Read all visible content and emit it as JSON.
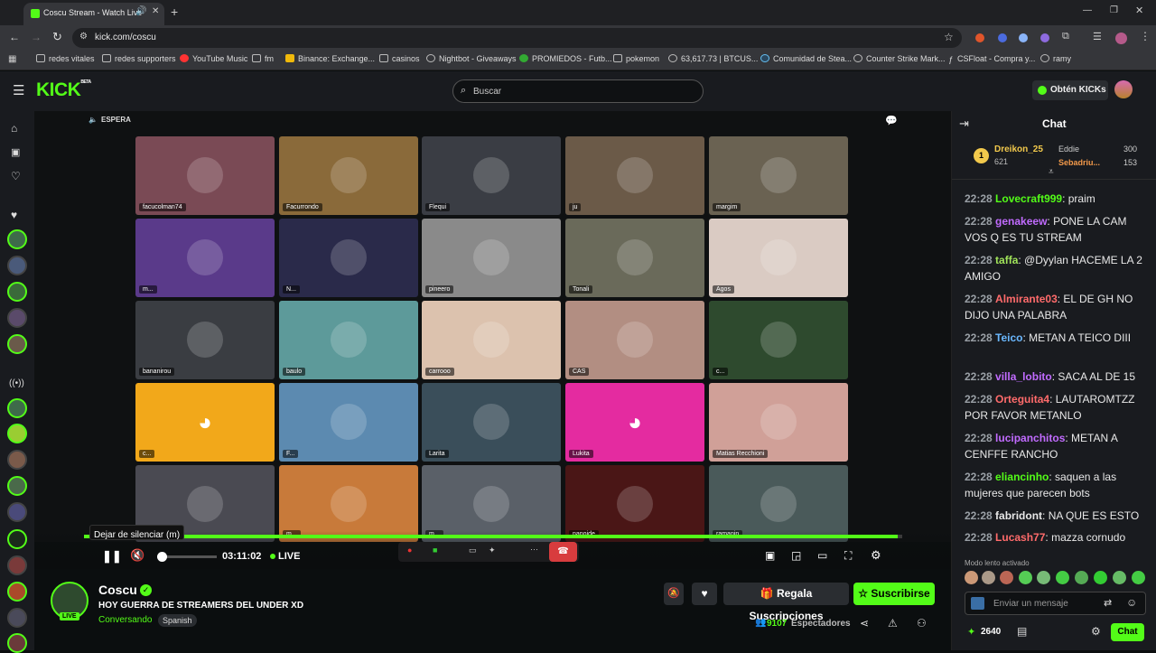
{
  "browser": {
    "tab_title": "Coscu Stream - Watch Live",
    "url": "kick.com/coscu",
    "bookmarks": [
      "redes vitales",
      "redes supporters",
      "YouTube Music",
      "fm",
      "Binance: Exchange...",
      "casinos",
      "Nightbot - Giveaways",
      "PROMIEDOS - Futb...",
      "pokemon",
      "63,617.73 | BTCUS...",
      "Comunidad de Stea...",
      "Counter Strike Mark...",
      "CSFloat - Compra y...",
      "ramy"
    ]
  },
  "header": {
    "logo": "KICK",
    "logo_badge": "BETA",
    "search_placeholder": "Buscar",
    "get_kicks": "Obtén KICKs"
  },
  "video": {
    "status": "ESPERA",
    "tiles": [
      {
        "name": "facucolman74",
        "color": "#7a4a55"
      },
      {
        "name": "Facurrondo",
        "color": "#8a6a3a"
      },
      {
        "name": "Flequi",
        "color": "#3a3d44"
      },
      {
        "name": "ju",
        "color": "#6b5a48"
      },
      {
        "name": "margim",
        "color": "#6a6252"
      },
      {
        "name": "m...",
        "color": "#5a3a8a"
      },
      {
        "name": "N...",
        "color": "#2a2a4a"
      },
      {
        "name": "pineero",
        "color": "#8a8a8a"
      },
      {
        "name": "Tonali",
        "color": "#6a6a5a"
      },
      {
        "name": "Agos",
        "color": "#dacbc3"
      },
      {
        "name": "bananirou",
        "color": "#3a3d42"
      },
      {
        "name": "baulo",
        "color": "#5d9a9a"
      },
      {
        "name": "carrooo",
        "color": "#dcc2ae"
      },
      {
        "name": "CAS",
        "color": "#b28e82"
      },
      {
        "name": "c...",
        "color": "#2e4a2e"
      },
      {
        "name": "c...",
        "color": "#f2a81a"
      },
      {
        "name": "F...",
        "color": "#5c8ab0"
      },
      {
        "name": "Larita",
        "color": "#3a4e5a"
      },
      {
        "name": "Lukita",
        "color": "#e42ba0"
      },
      {
        "name": "Matias Recchioni",
        "color": "#d0a098"
      },
      {
        "name": "",
        "color": "#4a4a52"
      },
      {
        "name": "m...",
        "color": "#c87a3a"
      },
      {
        "name": "m...",
        "color": "#5a6068"
      },
      {
        "name": "nanoide",
        "color": "#4a1616"
      },
      {
        "name": "ramanin",
        "color": "#4a5a5a"
      }
    ],
    "tooltip": "Dejar de silenciar (m)",
    "time": "03:11:02",
    "live": "LIVE",
    "progress": 0.995
  },
  "stream": {
    "channel": "Coscu",
    "title": "HOY GUERRA DE STREAMERS DEL UNDER XD",
    "category": "Conversando",
    "language": "Spanish",
    "live_badge": "LIVE",
    "gift_subs": "Regala Suscripciones",
    "subscribe": "Suscribirse",
    "viewers": "9107",
    "viewers_label": "Espectadores"
  },
  "chat": {
    "title": "Chat",
    "leaderboard": [
      {
        "name": "Dreikon_25",
        "value": "621"
      },
      {
        "name": "Eddie",
        "value": "300"
      },
      {
        "name": "Sebadriu...",
        "value": "153"
      }
    ],
    "messages": [
      {
        "time": "22:28",
        "user": "Lovecraft999",
        "color": "#53fc18",
        "text": ": praim"
      },
      {
        "time": "22:28",
        "user": "genakeew",
        "color": "#c16bff",
        "text": ": PONE LA CAM VOS Q ES TU STREAM"
      },
      {
        "time": "22:28",
        "user": "taffa",
        "color": "#a0e35a",
        "text": ": @Dyylan HACEME LA 2 AMIGO"
      },
      {
        "time": "22:28",
        "user": "Almirante03",
        "color": "#ff6b6b",
        "text": ": EL DE GH NO DIJO UNA PALABRA"
      },
      {
        "time": "22:28",
        "user": "Teico",
        "color": "#6ab8ff",
        "text": ": METAN A TEICO DIII"
      },
      {
        "time": "22:28",
        "user": "villa_lobito",
        "color": "#c16bff",
        "text": ": SACA AL DE 15"
      },
      {
        "time": "22:28",
        "user": "Orteguita4",
        "color": "#ff6b6b",
        "text": ": LAUTAROMTZZ POR FAVOR METANLO"
      },
      {
        "time": "22:28",
        "user": "lucipanchitos",
        "color": "#c16bff",
        "text": ": METAN A CENFFE RANCHO"
      },
      {
        "time": "22:28",
        "user": "eliancinho",
        "color": "#53fc18",
        "text": ": saquen a las mujeres que parecen bots"
      },
      {
        "time": "22:28",
        "user": "fabridont",
        "color": "#e8e8e8",
        "text": ": NA QUE ES ESTO"
      },
      {
        "time": "22:28",
        "user": "Lucash77",
        "color": "#ff6b6b",
        "text": ": mazza cornudo"
      }
    ],
    "slow_mode": "Modo lento activado",
    "input_placeholder": "Enviar un mensaje",
    "points": "2640",
    "send": "Chat"
  }
}
